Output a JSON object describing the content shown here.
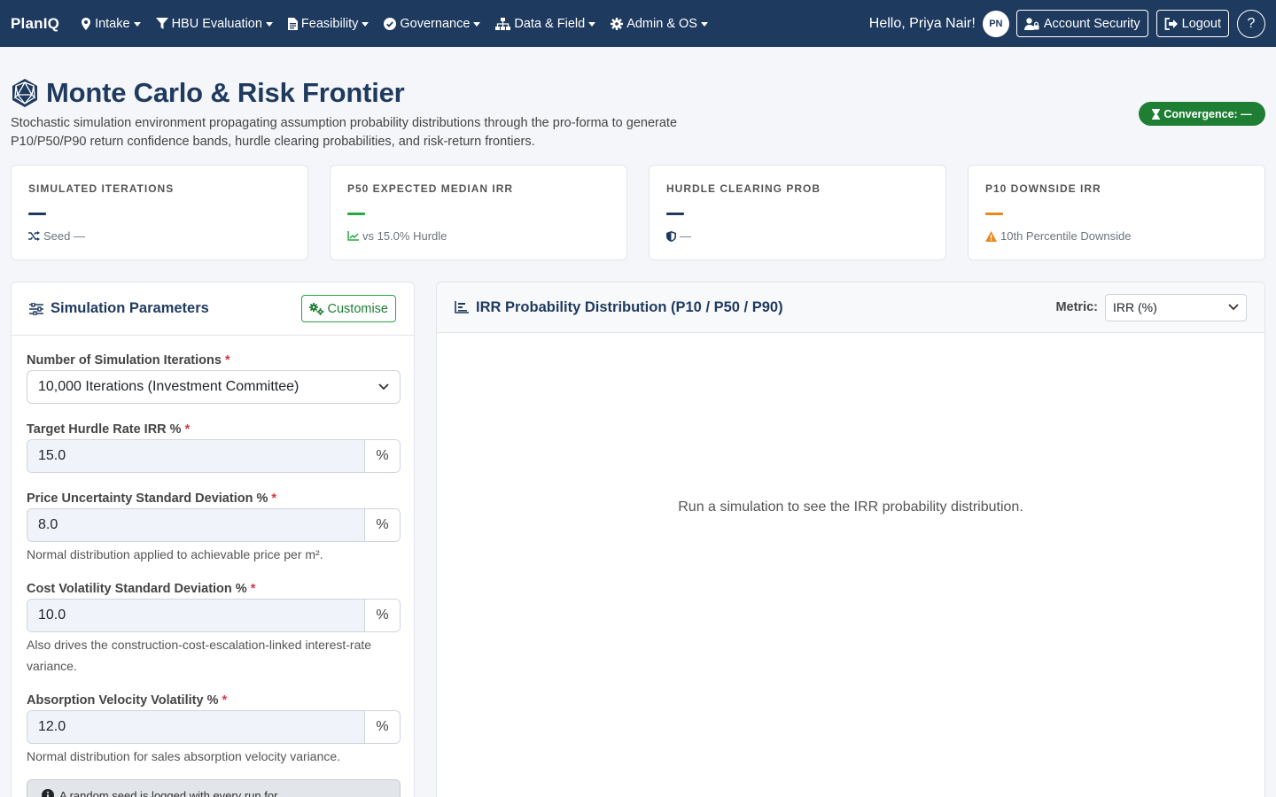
{
  "nav": {
    "brand": "PlanIQ",
    "items": [
      {
        "label": "Intake",
        "icon": "map-marker-icon"
      },
      {
        "label": "HBU Evaluation",
        "icon": "filter-icon"
      },
      {
        "label": "Feasibility",
        "icon": "file-icon"
      },
      {
        "label": "Governance",
        "icon": "check-circle-icon"
      },
      {
        "label": "Data & Field",
        "icon": "sitemap-icon"
      },
      {
        "label": "Admin & OS",
        "icon": "gear-icon"
      }
    ],
    "greeting": "Hello, Priya Nair!",
    "avatar_initials": "PN",
    "account_security": "Account Security",
    "logout": "Logout",
    "help": "?"
  },
  "header": {
    "title": "Monte Carlo & Risk Frontier",
    "subtitle": "Stochastic simulation environment propagating assumption probability distributions through the pro-forma to generate P10/P50/P90 return confidence bands, hurdle clearing probabilities, and risk-return frontiers.",
    "convergence_badge": "Convergence: —"
  },
  "kpis": [
    {
      "label": "SIMULATED ITERATIONS",
      "color": "#1f3a5f",
      "foot": "Seed —",
      "icon": "shuffle-icon",
      "icon_color": "#1f3a5f"
    },
    {
      "label": "P50 EXPECTED MEDIAN IRR",
      "color": "#28a745",
      "foot": "vs 15.0% Hurdle",
      "icon": "line-chart-icon",
      "icon_color": "#28a745"
    },
    {
      "label": "HURDLE CLEARING PROB",
      "color": "#1f3a5f",
      "foot": "—",
      "icon": "shield-icon",
      "icon_color": "#1f3a5f"
    },
    {
      "label": "P10 DOWNSIDE IRR",
      "color": "#e8891c",
      "foot": "10th Percentile Downside",
      "icon": "warning-icon",
      "icon_color": "#e8891c"
    }
  ],
  "params": {
    "title": "Simulation Parameters",
    "customise": "Customise",
    "required_mark": "*",
    "iterations": {
      "label": "Number of Simulation Iterations",
      "value": "10,000 Iterations (Investment Committee)"
    },
    "hurdle": {
      "label": "Target Hurdle Rate IRR %",
      "value": "15.0",
      "unit": "%"
    },
    "price_sd": {
      "label": "Price Uncertainty Standard Deviation %",
      "value": "8.0",
      "unit": "%",
      "help": "Normal distribution applied to achievable price per m²."
    },
    "cost_sd": {
      "label": "Cost Volatility Standard Deviation %",
      "value": "10.0",
      "unit": "%",
      "help": "Also drives the construction-cost-escalation-linked interest-rate variance."
    },
    "absorption": {
      "label": "Absorption Velocity Volatility %",
      "value": "12.0",
      "unit": "%",
      "help": "Normal distribution for sales absorption velocity variance."
    },
    "alert": "A random seed is logged with every run for"
  },
  "chart_panel": {
    "title": "IRR Probability Distribution (P10 / P50 / P90)",
    "metric_label": "Metric:",
    "metric_value": "IRR (%)",
    "empty_message": "Run a simulation to see the IRR probability distribution."
  }
}
